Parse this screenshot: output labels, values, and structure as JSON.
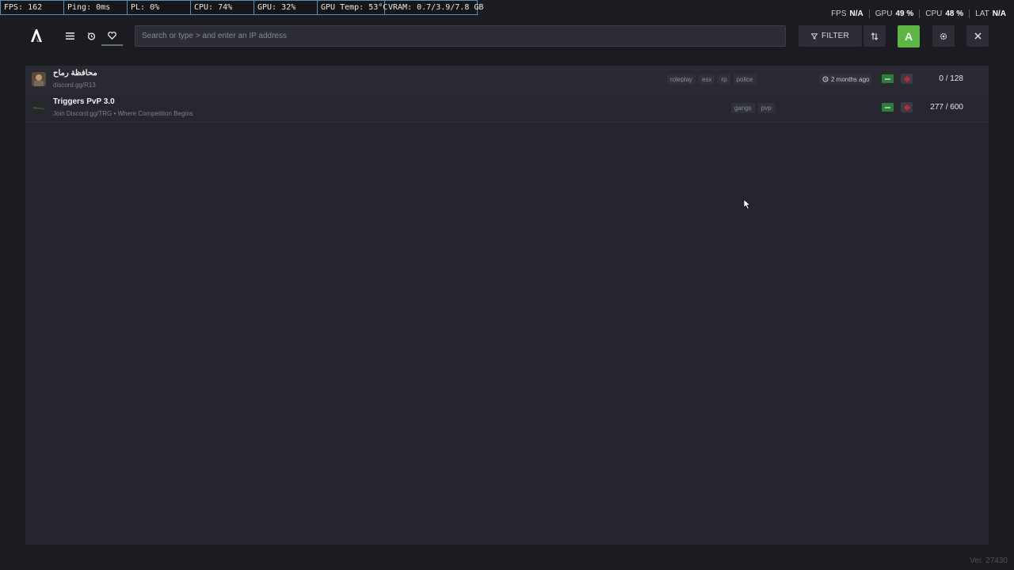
{
  "perf_overlay": {
    "fps": "FPS: 162",
    "ping": "Ping: 0ms",
    "pl": "PL: 0%",
    "cpu": "CPU: 74%",
    "gpu": "GPU: 32%",
    "gpu_temp": "GPU Temp: 53°C",
    "vram": "VRAM: 0.7/3.9/7.8 GB"
  },
  "stats": [
    {
      "label": "FPS",
      "value": "N/A"
    },
    {
      "label": "GPU",
      "value": "49 %"
    },
    {
      "label": "CPU",
      "value": "48 %"
    },
    {
      "label": "LAT",
      "value": "N/A"
    }
  ],
  "nav": {
    "menu_icon": "menu-icon",
    "history_icon": "history-icon",
    "favorites_icon": "heart-icon"
  },
  "search": {
    "placeholder": "Search or type > and enter an IP address",
    "value": ""
  },
  "toolbar": {
    "filter_label": "FILTER",
    "sort_icon": "sort-icon",
    "avatar_letter": "A",
    "settings_icon": "settings-icon",
    "close_icon": "close-icon"
  },
  "colors": {
    "accent_green": "#5fb543",
    "background": "#1b1c21",
    "panel": "#25262d",
    "perf_border": "#5a8fb0"
  },
  "servers": [
    {
      "name": "محافظة رماح",
      "description": "discord.gg/R13",
      "tags": [
        "roleplay",
        "esx",
        "rp",
        "police"
      ],
      "last_seen": "2 months ago",
      "players": "0 / 128"
    },
    {
      "name": "Triggers PvP 3.0",
      "description": "Join Discord.gg/TRG • Where Competition Begins",
      "tags": [
        "gangs",
        "pvp"
      ],
      "last_seen": "",
      "players": "277 / 600"
    }
  ],
  "version": "Ver. 27430"
}
